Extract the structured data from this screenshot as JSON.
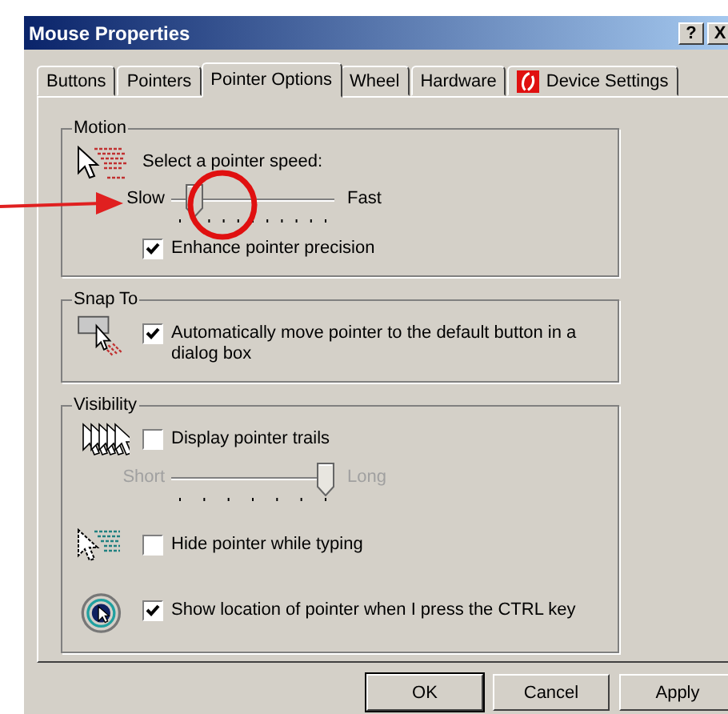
{
  "window": {
    "title": "Mouse Properties",
    "help_button": "?",
    "close_button": "X"
  },
  "tabs": [
    {
      "label": "Buttons",
      "selected": false
    },
    {
      "label": "Pointers",
      "selected": false
    },
    {
      "label": "Pointer Options",
      "selected": true
    },
    {
      "label": "Wheel",
      "selected": false
    },
    {
      "label": "Hardware",
      "selected": false
    },
    {
      "label": "Device Settings",
      "selected": false,
      "kind": "icon"
    }
  ],
  "groups": [
    {
      "title": "Motion",
      "sections": [
        {
          "controls": [
            {
              "kind": "prompt",
              "text": "Select a pointer speed:"
            },
            {
              "kind": "slider",
              "min_label": "Slow",
              "max_label": "Fast",
              "level": 0.1,
              "disabled": false
            },
            {
              "kind": "checkbox",
              "label": "Enhance pointer precision",
              "checked": true
            }
          ]
        }
      ]
    },
    {
      "title": "Snap To",
      "sections": [
        {
          "controls": [
            {
              "kind": "checkbox",
              "label": "Automatically move pointer to the default button in a dialog box",
              "checked": true
            }
          ]
        }
      ]
    },
    {
      "title": "Visibility",
      "sections": [
        {
          "controls": [
            {
              "kind": "checkbox",
              "label": "Display pointer trails",
              "checked": false
            },
            {
              "kind": "slider",
              "min_label": "Short",
              "max_label": "Long",
              "level": 1,
              "disabled": true
            }
          ]
        },
        {
          "controls": [
            {
              "kind": "checkbox",
              "label": "Hide pointer while typing",
              "checked": false
            }
          ]
        },
        {
          "controls": [
            {
              "kind": "checkbox",
              "label": "Show location of pointer when I press the CTRL key",
              "checked": true
            }
          ]
        }
      ]
    }
  ],
  "buttons": [
    {
      "label": "OK",
      "default": true
    },
    {
      "label": "Cancel",
      "default": false
    },
    {
      "label": "Apply",
      "default": false
    }
  ]
}
